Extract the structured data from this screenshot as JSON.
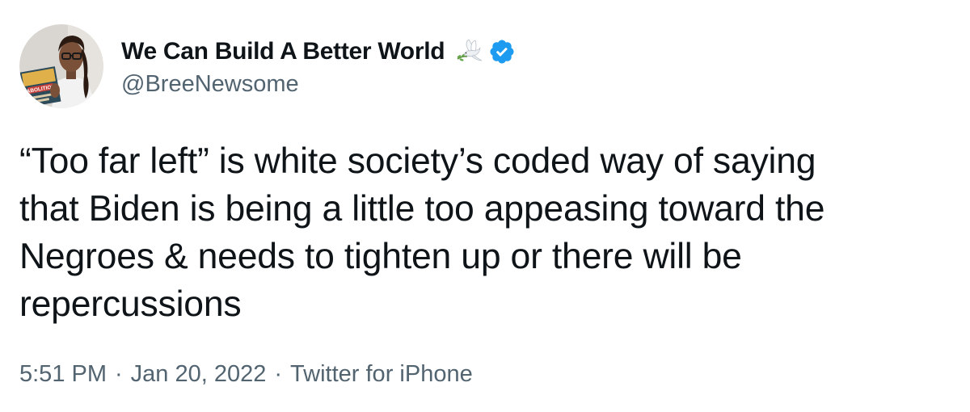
{
  "author": {
    "display_name": "We Can Build A Better World",
    "handle": "@BreeNewsome",
    "avatar_book_title": "ABOLITION",
    "name_emoji": "dove-icon",
    "verified_badge": "verified-icon"
  },
  "tweet": {
    "text": "“Too far left” is white society’s coded way of saying\nthat Biden is being a little too appeasing toward the\nNegroes & needs to tighten up or there will be\nrepercussions"
  },
  "meta": {
    "time": "5:51 PM",
    "date": "Jan 20, 2022",
    "separator": "·",
    "source": "Twitter for iPhone"
  },
  "colors": {
    "text_primary": "#0f1419",
    "text_secondary": "#536471",
    "verified_blue": "#1d9bf0",
    "background": "#ffffff"
  }
}
